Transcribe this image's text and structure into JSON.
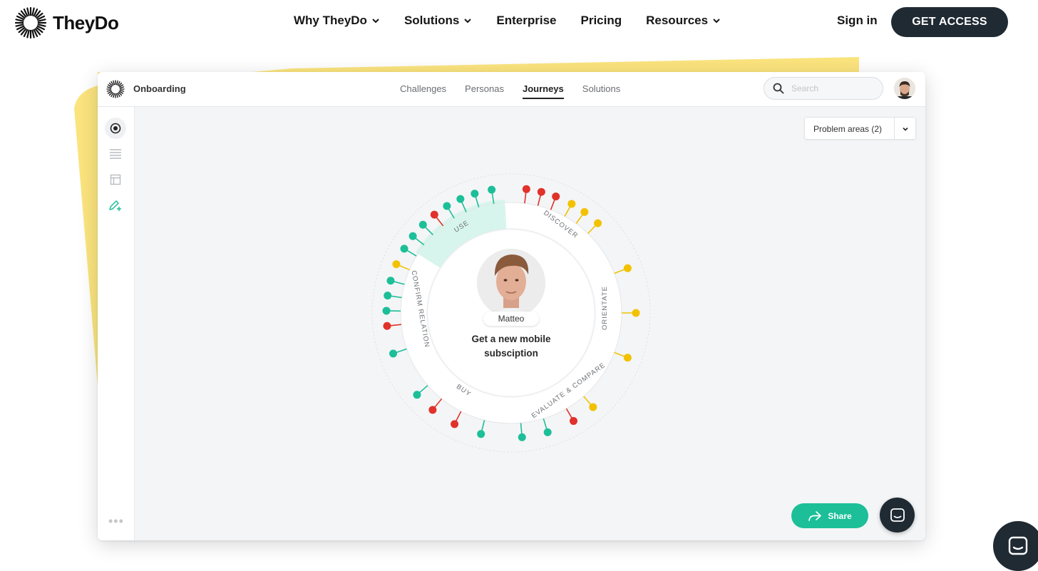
{
  "site": {
    "brand": "TheyDo",
    "nav": [
      {
        "label": "Why TheyDo",
        "dropdown": true
      },
      {
        "label": "Solutions",
        "dropdown": true
      },
      {
        "label": "Enterprise",
        "dropdown": false
      },
      {
        "label": "Pricing",
        "dropdown": false
      },
      {
        "label": "Resources",
        "dropdown": true
      }
    ],
    "sign_in": "Sign in",
    "cta": "GET ACCESS"
  },
  "app": {
    "workspace": "Onboarding",
    "tabs": [
      "Challenges",
      "Personas",
      "Journeys",
      "Solutions"
    ],
    "active_tab": "Journeys",
    "search_placeholder": "Search",
    "problem_filter": "Problem areas (2)",
    "persona": "Matteo",
    "journey_title_line1": "Get a new mobile",
    "journey_title_line2": "subsciption",
    "stages": [
      "USE",
      "DISCOVER",
      "ORIENTATE",
      "EVALUATE & COMPARE",
      "BUY",
      "CONFIRM RELATION"
    ],
    "share": "Share"
  },
  "colors": {
    "accent": "#1cbf98",
    "red": "#e0322a",
    "yellow": "#f2c200",
    "dark": "#1f2a33",
    "brand_yellow": "#fbe47e"
  },
  "icons": [
    "logo-sunburst",
    "chevron-down",
    "search",
    "target",
    "list",
    "layout",
    "pen-plus",
    "share-arrow",
    "chat"
  ]
}
